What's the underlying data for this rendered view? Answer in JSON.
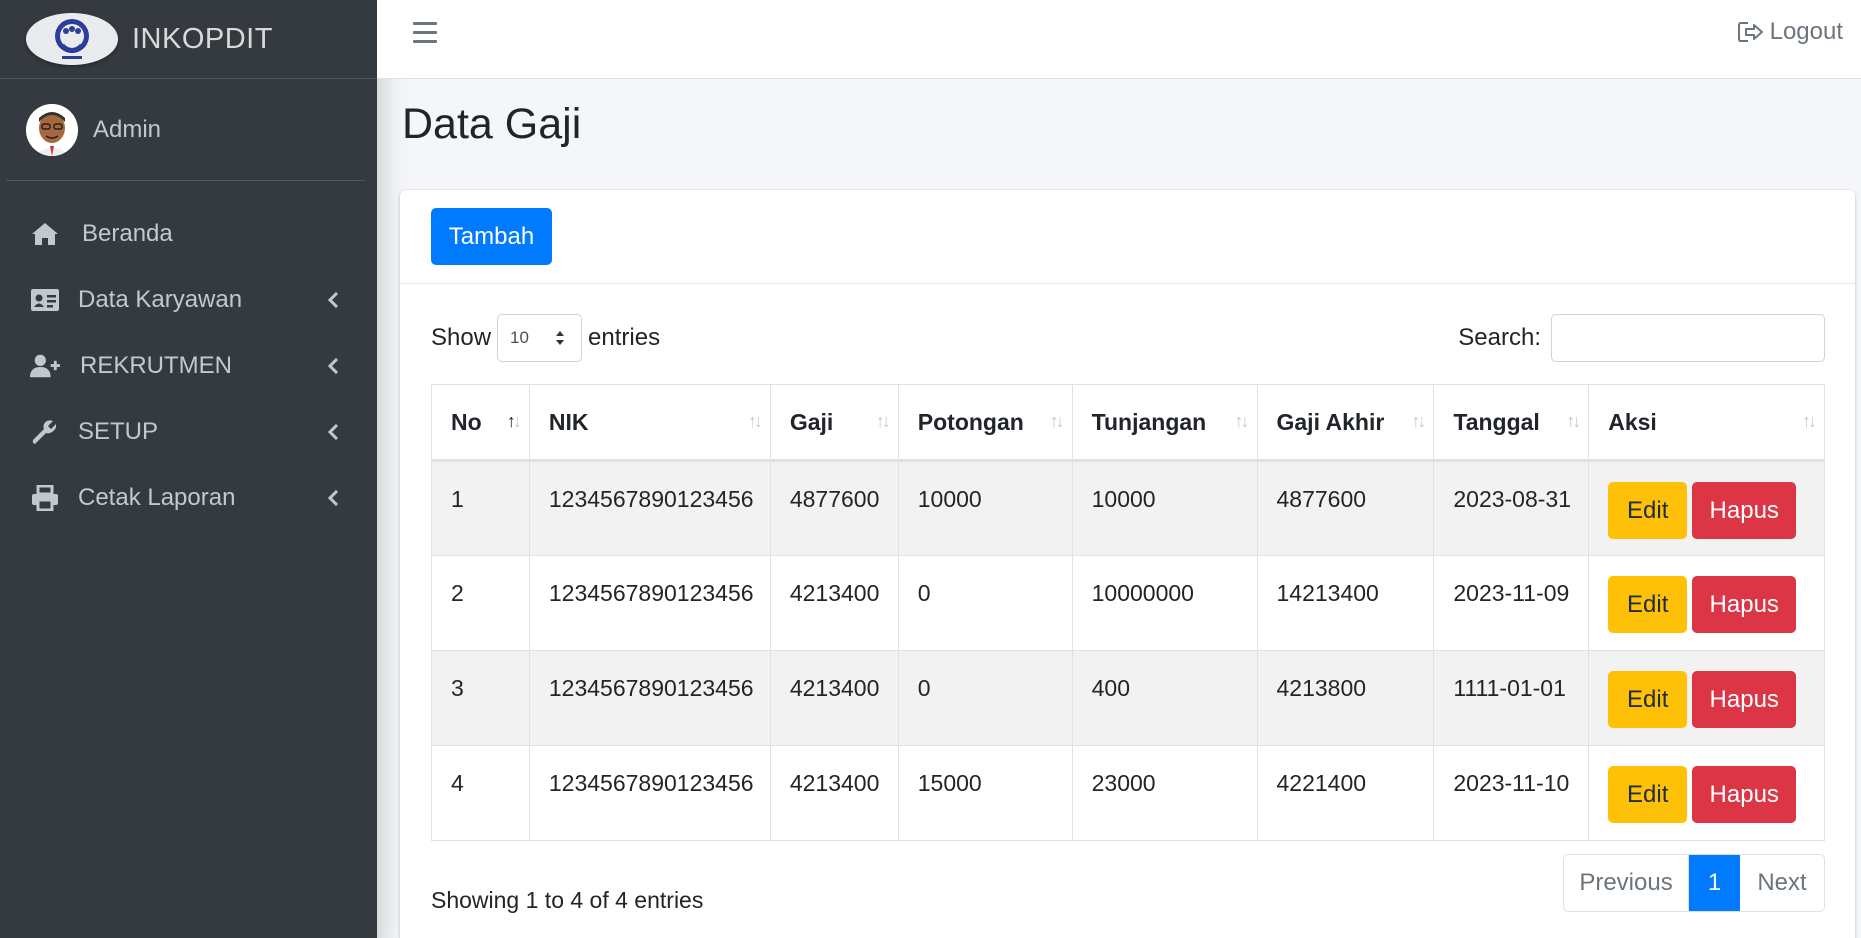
{
  "brand": {
    "name": "INKOPDIT"
  },
  "user": {
    "name": "Admin"
  },
  "sidebar": {
    "items": [
      {
        "label": "Beranda",
        "icon": "home-icon",
        "has_children": false
      },
      {
        "label": "Data Karyawan",
        "icon": "id-card-icon",
        "has_children": true
      },
      {
        "label": "REKRUTMEN",
        "icon": "user-plus-icon",
        "has_children": true
      },
      {
        "label": "SETUP",
        "icon": "wrench-icon",
        "has_children": true
      },
      {
        "label": "Cetak Laporan",
        "icon": "printer-icon",
        "has_children": true
      }
    ]
  },
  "topbar": {
    "logout_label": "Logout"
  },
  "page": {
    "title": "Data Gaji"
  },
  "toolbar": {
    "add_label": "Tambah"
  },
  "table_controls": {
    "show_label": "Show",
    "page_size": "10",
    "entries_label": "entries",
    "search_label": "Search:"
  },
  "table": {
    "headers": [
      "No",
      "NIK",
      "Gaji",
      "Potongan",
      "Tunjangan",
      "Gaji Akhir",
      "Tanggal",
      "Aksi"
    ],
    "rows": [
      {
        "no": "1",
        "nik": "1234567890123456",
        "gaji": "4877600",
        "potongan": "10000",
        "tunjangan": "10000",
        "gaji_akhir": "4877600",
        "tanggal": "2023-08-31"
      },
      {
        "no": "2",
        "nik": "1234567890123456",
        "gaji": "4213400",
        "potongan": "0",
        "tunjangan": "10000000",
        "gaji_akhir": "14213400",
        "tanggal": "2023-11-09"
      },
      {
        "no": "3",
        "nik": "1234567890123456",
        "gaji": "4213400",
        "potongan": "0",
        "tunjangan": "400",
        "gaji_akhir": "4213800",
        "tanggal": "1111-01-01"
      },
      {
        "no": "4",
        "nik": "1234567890123456",
        "gaji": "4213400",
        "potongan": "15000",
        "tunjangan": "23000",
        "gaji_akhir": "4221400",
        "tanggal": "2023-11-10"
      }
    ],
    "edit_label": "Edit",
    "delete_label": "Hapus"
  },
  "footer": {
    "info": "Showing 1 to 4 of 4 entries",
    "prev_label": "Previous",
    "current_page": "1",
    "next_label": "Next"
  },
  "colors": {
    "sidebar_bg": "#343a40",
    "primary": "#007bff",
    "warning": "#ffc107",
    "danger": "#dc3545"
  }
}
